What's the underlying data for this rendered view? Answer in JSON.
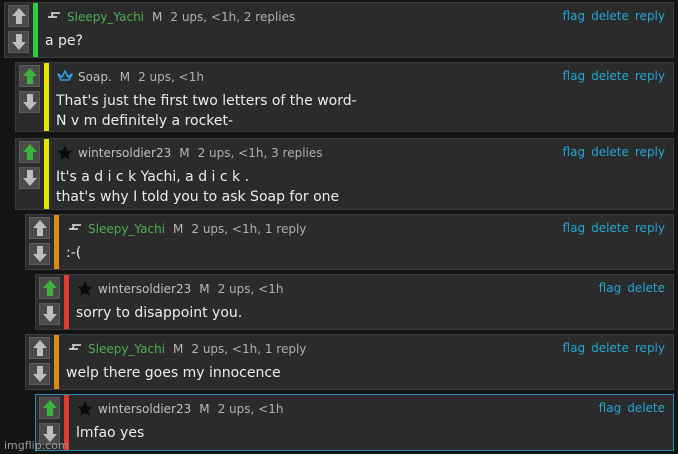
{
  "comments": [
    {
      "username": "Sleepy_Yachi",
      "tag": "M",
      "meta": "2 ups, <1h, 2 replies",
      "badge": "dash-badge-icon",
      "name_color": "#4caf50",
      "bar_color": "#2ecc40",
      "up_arrow_color": "#bdbdbd",
      "lines": [
        "a pe?"
      ],
      "actions": [
        "flag",
        "delete",
        "reply"
      ]
    },
    {
      "username": "Soap.",
      "tag": "M",
      "meta": "2 ups, <1h",
      "badge": "crown-icon",
      "name_color": "#c0c0c0",
      "bar_color": "#e6e600",
      "up_arrow_color": "#3db33d",
      "lines": [
        "That's just the first two letters of the word-",
        "N v m definitely a rocket-"
      ],
      "actions": [
        "flag",
        "delete",
        "reply"
      ]
    },
    {
      "username": "wintersoldier23",
      "tag": "M",
      "meta": "2 ups, <1h, 3 replies",
      "badge": "star-icon",
      "name_color": "#c0c0c0",
      "bar_color": "#e6e600",
      "up_arrow_color": "#3db33d",
      "lines": [
        "It's a d i c k Yachi, a d i c k .",
        "that's why I told you to ask Soap for one"
      ],
      "actions": [
        "flag",
        "delete",
        "reply"
      ]
    },
    {
      "username": "Sleepy_Yachi",
      "tag": "M",
      "meta": "2 ups, <1h, 1 reply",
      "badge": "dash-badge-icon",
      "name_color": "#4caf50",
      "bar_color": "#e08a1e",
      "up_arrow_color": "#bdbdbd",
      "lines": [
        ":-("
      ],
      "actions": [
        "flag",
        "delete",
        "reply"
      ]
    },
    {
      "username": "wintersoldier23",
      "tag": "M",
      "meta": "2 ups, <1h",
      "badge": "star-icon",
      "name_color": "#c0c0c0",
      "bar_color": "#e53935",
      "up_arrow_color": "#3db33d",
      "lines": [
        "sorry to disappoint you."
      ],
      "actions": [
        "flag",
        "delete"
      ]
    },
    {
      "username": "Sleepy_Yachi",
      "tag": "M",
      "meta": "2 ups, <1h, 1 reply",
      "badge": "dash-badge-icon",
      "name_color": "#4caf50",
      "bar_color": "#e08a1e",
      "up_arrow_color": "#bdbdbd",
      "lines": [
        "welp there goes my innocence"
      ],
      "actions": [
        "flag",
        "delete",
        "reply"
      ]
    },
    {
      "username": "wintersoldier23",
      "tag": "M",
      "meta": "2 ups, <1h",
      "badge": "star-icon",
      "name_color": "#c0c0c0",
      "bar_color": "#e53935",
      "up_arrow_color": "#3db33d",
      "lines": [
        "lmfao yes"
      ],
      "actions": [
        "flag",
        "delete"
      ]
    }
  ],
  "watermark": "imgflip.com"
}
